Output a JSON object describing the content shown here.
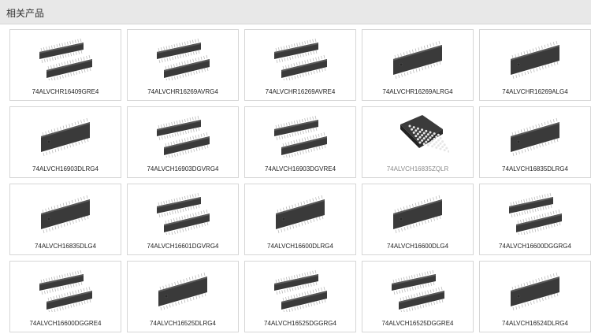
{
  "header": {
    "title": "相关产品"
  },
  "products": [
    {
      "name": "74ALVCHR16409GRE4",
      "icon": "tssop-pair-icon",
      "muted": false
    },
    {
      "name": "74ALVCHR16269AVRG4",
      "icon": "tssop-pair-icon",
      "muted": false
    },
    {
      "name": "74ALVCHR16269AVRE4",
      "icon": "tssop-pair-icon",
      "muted": false
    },
    {
      "name": "74ALVCHR16269ALRG4",
      "icon": "ssop-icon",
      "muted": false
    },
    {
      "name": "74ALVCHR16269ALG4",
      "icon": "ssop-icon",
      "muted": false
    },
    {
      "name": "74ALVCH16903DLRG4",
      "icon": "ssop-icon",
      "muted": false
    },
    {
      "name": "74ALVCH16903DGVRG4",
      "icon": "tssop-pair-icon",
      "muted": false
    },
    {
      "name": "74ALVCH16903DGVRE4",
      "icon": "tssop-pair-icon",
      "muted": false
    },
    {
      "name": "74ALVCH16835ZQLR",
      "icon": "bga-icon",
      "muted": true
    },
    {
      "name": "74ALVCH16835DLRG4",
      "icon": "ssop-icon",
      "muted": false
    },
    {
      "name": "74ALVCH16835DLG4",
      "icon": "ssop-icon",
      "muted": false
    },
    {
      "name": "74ALVCH16601DGVRG4",
      "icon": "tssop-pair-icon",
      "muted": false
    },
    {
      "name": "74ALVCH16600DLRG4",
      "icon": "ssop-icon",
      "muted": false
    },
    {
      "name": "74ALVCH16600DLG4",
      "icon": "ssop-icon",
      "muted": false
    },
    {
      "name": "74ALVCH16600DGGRG4",
      "icon": "tssop-pair-icon",
      "muted": false
    },
    {
      "name": "74ALVCH16600DGGRE4",
      "icon": "tssop-pair-icon",
      "muted": false
    },
    {
      "name": "74ALVCH16525DLRG4",
      "icon": "ssop-icon",
      "muted": false
    },
    {
      "name": "74ALVCH16525DGGRG4",
      "icon": "tssop-pair-icon",
      "muted": false
    },
    {
      "name": "74ALVCH16525DGGRE4",
      "icon": "tssop-pair-icon",
      "muted": false
    },
    {
      "name": "74ALVCH16524DLRG4",
      "icon": "ssop-icon",
      "muted": false
    }
  ]
}
